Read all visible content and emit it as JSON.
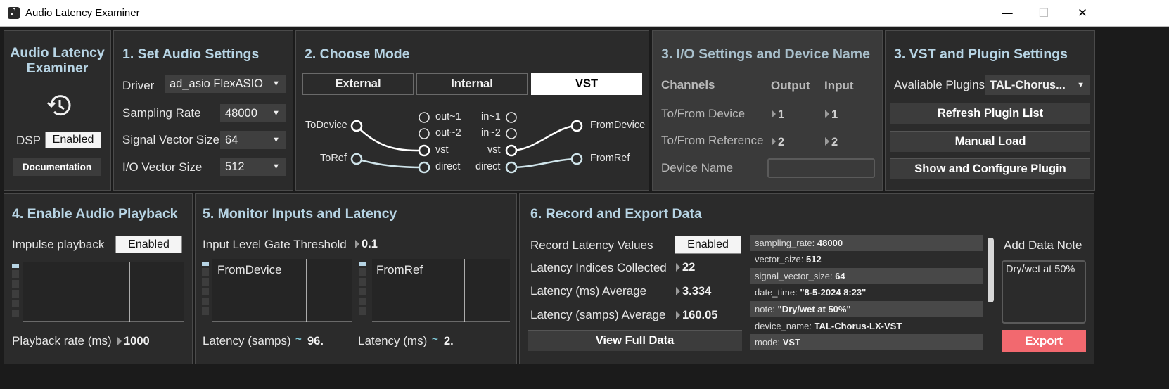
{
  "window": {
    "title": "Audio Latency Examiner",
    "minimize": "—",
    "maximize": "☐",
    "close": "✕"
  },
  "header": {
    "title_line1": "Audio Latency",
    "title_line2": "Examiner",
    "dsp_label": "DSP",
    "dsp_toggle": "Enabled",
    "documentation": "Documentation"
  },
  "audio_settings": {
    "title": "1. Set Audio Settings",
    "driver_label": "Driver",
    "driver_value": "ad_asio FlexASIO",
    "sr_label": "Sampling Rate",
    "sr_value": "48000",
    "svs_label": "Signal Vector Size",
    "svs_value": "64",
    "io_label": "I/O Vector Size",
    "io_value": "512"
  },
  "mode": {
    "title": "2. Choose Mode",
    "buttons": [
      "External",
      "Internal",
      "VST"
    ],
    "selected": "VST",
    "routing": {
      "to_device": "ToDevice",
      "to_ref": "ToRef",
      "out1": "out~1",
      "out2": "out~2",
      "vst_left": "vst",
      "direct_left": "direct",
      "in1": "in~1",
      "in2": "in~2",
      "vst_right": "vst",
      "direct_right": "direct",
      "from_device": "FromDevice",
      "from_ref": "FromRef"
    }
  },
  "io_settings": {
    "title": "3. I/O Settings and Device Name",
    "channels": "Channels",
    "output": "Output",
    "input": "Input",
    "to_from_device": "To/From Device",
    "device_out": "1",
    "device_in": "1",
    "to_from_ref": "To/From Reference",
    "ref_out": "2",
    "ref_in": "2",
    "device_name_label": "Device Name",
    "device_name_value": ""
  },
  "vst_settings": {
    "title": "3. VST and Plugin Settings",
    "plugins_label": "Avaliable Plugins",
    "plugins_value": "TAL-Chorus...",
    "refresh": "Refresh Plugin List",
    "manual_load": "Manual Load",
    "show_configure": "Show and Configure Plugin"
  },
  "playback": {
    "title": "4. Enable Audio Playback",
    "impulse_label": "Impulse playback",
    "impulse_toggle": "Enabled",
    "rate_label": "Playback rate (ms)",
    "rate_value": "1000"
  },
  "monitor": {
    "title": "5. Monitor Inputs and Latency",
    "gate_label": "Input Level Gate Threshold",
    "gate_value": "0.1",
    "scope1_label": "FromDevice",
    "scope2_label": "FromRef",
    "lat_samps_label": "Latency (samps)",
    "lat_samps_value": "96.",
    "lat_ms_label": "Latency (ms)",
    "lat_ms_value": "2."
  },
  "record": {
    "title": "6. Record and Export Data",
    "record_label": "Record Latency Values",
    "record_toggle": "Enabled",
    "collected_label": "Latency Indices Collected",
    "collected_value": "22",
    "ms_avg_label": "Latency (ms) Average",
    "ms_avg_value": "3.334",
    "samps_avg_label": "Latency (samps) Average",
    "samps_avg_value": "160.05",
    "view_full": "View Full Data",
    "data_rows": [
      {
        "key": "sampling_rate:",
        "value": "48000"
      },
      {
        "key": "vector_size:",
        "value": "512"
      },
      {
        "key": "signal_vector_size:",
        "value": "64"
      },
      {
        "key": "date_time:",
        "value": "\"8-5-2024 8:23\""
      },
      {
        "key": "note:",
        "value": "\"Dry/wet at 50%\""
      },
      {
        "key": "device_name:",
        "value": "TAL-Chorus-LX-VST"
      },
      {
        "key": "mode:",
        "value": "VST"
      }
    ],
    "note_title": "Add Data Note",
    "note_text": "Dry/wet at 50%",
    "export": "Export"
  },
  "colors": {
    "accent_title": "#b7d4e4",
    "export_button": "#f2696f",
    "cable_white": "#ffffff",
    "cable_teal": "#cfe4ea"
  }
}
